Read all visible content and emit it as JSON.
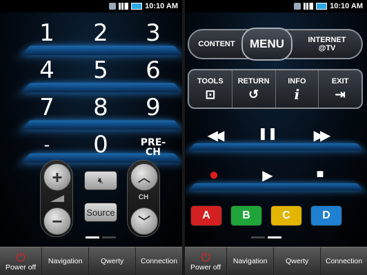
{
  "status_bar": {
    "time": "10:10 AM"
  },
  "left_panel": {
    "number_keys": [
      [
        "1",
        "2",
        "3"
      ],
      [
        "4",
        "5",
        "6"
      ],
      [
        "7",
        "8",
        "9"
      ]
    ],
    "dash_key": "-",
    "zero_key": "0",
    "prech_line1": "PRE-",
    "prech_line2": "CH",
    "volume_up": "+",
    "volume_down": "−",
    "mute_icon": "mute-icon",
    "source_label": "Source",
    "channel_label": "CH",
    "channel_up_icon": "chevron-up-icon",
    "channel_down_icon": "chevron-down-icon"
  },
  "right_panel": {
    "content_label": "CONTENT",
    "menu_label": "MENU",
    "internet_line1": "INTERNET",
    "internet_line2": "@TV",
    "tools": [
      {
        "label": "TOOLS",
        "icon": "tools-icon",
        "glyph": "⊡"
      },
      {
        "label": "RETURN",
        "icon": "return-icon",
        "glyph": "↺"
      },
      {
        "label": "INFO",
        "icon": "info-icon",
        "glyph": "i"
      },
      {
        "label": "EXIT",
        "icon": "exit-icon",
        "glyph": "⇥"
      }
    ],
    "media": {
      "rewind": "◀◀",
      "pause": "❚❚",
      "fast_forward": "▶▶",
      "record": "●",
      "play": "▶",
      "stop": "■"
    },
    "color_buttons": [
      {
        "label": "A",
        "color": "#d42020"
      },
      {
        "label": "B",
        "color": "#1fa53a"
      },
      {
        "label": "C",
        "color": "#e3b400"
      },
      {
        "label": "D",
        "color": "#1f7fd0"
      }
    ]
  },
  "bottom_bar": {
    "power_label": "Power off",
    "power_icon": "power-icon",
    "power_color": "#e02020",
    "tabs": [
      "Navigation",
      "Qwerty",
      "Connection"
    ]
  }
}
